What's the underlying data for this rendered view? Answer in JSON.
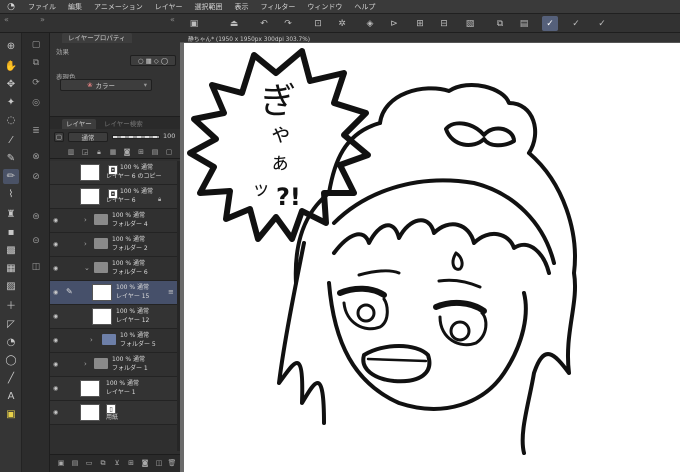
{
  "menu": {
    "items": [
      "ファイル",
      "編集",
      "アニメーション",
      "レイヤー",
      "選択範囲",
      "表示",
      "フィルター",
      "ウィンドウ",
      "ヘルプ"
    ]
  },
  "property_panel": {
    "tab_label": "レイヤープロパティ",
    "effect_label": "効果",
    "display_color_label": "表現色",
    "color_value": "カラー"
  },
  "layer_panel": {
    "tab_layer": "レイヤー",
    "tab_search": "レイヤー検索",
    "blend_mode": "通常",
    "opacity": "100",
    "layers": [
      {
        "name": "レイヤー 6 のコピー",
        "info": "100 % 通常",
        "type": "raster",
        "visible": false,
        "indent": 0
      },
      {
        "name": "レイヤー 6",
        "info": "100 % 通常",
        "type": "raster",
        "visible": false,
        "indent": 0
      },
      {
        "name": "フォルダー 4",
        "info": "100 % 通常",
        "type": "folder",
        "visible": true,
        "indent": 0
      },
      {
        "name": "フォルダー 2",
        "info": "100 % 通常",
        "type": "folder",
        "visible": true,
        "indent": 0
      },
      {
        "name": "フォルダー 6",
        "info": "100 % 通常",
        "type": "folder",
        "visible": true,
        "indent": 0
      },
      {
        "name": "レイヤー 15",
        "info": "100 % 通常",
        "type": "raster",
        "visible": true,
        "indent": 1,
        "active": true
      },
      {
        "name": "レイヤー 12",
        "info": "100 % 通常",
        "type": "raster",
        "visible": true,
        "indent": 1
      },
      {
        "name": "フォルダー 5",
        "info": "10 % 通常",
        "type": "folder",
        "visible": true,
        "indent": 1
      },
      {
        "name": "フォルダー 1",
        "info": "100 % 通常",
        "type": "folder",
        "visible": true,
        "indent": 0
      },
      {
        "name": "レイヤー 1",
        "info": "100 % 通常",
        "type": "raster",
        "visible": true,
        "indent": 0
      },
      {
        "name": "用紙",
        "info": "",
        "type": "paper",
        "visible": true,
        "indent": 0
      }
    ]
  },
  "canvas": {
    "tab_title": "静ちゃん* (1950 x 1950px 300dpi 303.7%)",
    "text_lines": [
      "ぎ",
      "ゃ",
      "ぁ",
      "ッ",
      "?!"
    ]
  }
}
